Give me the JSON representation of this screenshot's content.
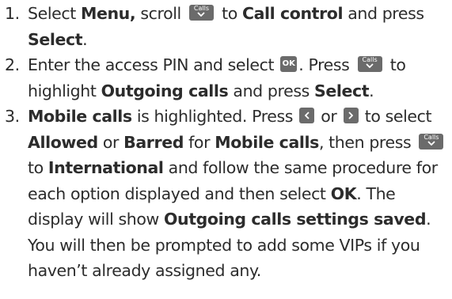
{
  "steps": [
    {
      "number": "1.",
      "s1": "Select ",
      "b1": "Menu,",
      "s2": " scroll ",
      "key1": "Calls",
      "s3": " to ",
      "b2": "Call control",
      "s4": " and press ",
      "b3": "Select",
      "s5": "."
    },
    {
      "number": "2.",
      "s1": "Enter the access PIN and select ",
      "key_ok": "OK",
      "s2": ". Press ",
      "key1": "Calls",
      "s3": " to highlight ",
      "b1": "Outgoing calls",
      "s4": " and press ",
      "b2": "Select",
      "s5": "."
    },
    {
      "number": "3.",
      "b1": "Mobile calls",
      "s1": " is highlighted. Press ",
      "left_key": "chevron-left-icon",
      "s2": " or ",
      "right_key": "chevron-right-icon",
      "s3": " to select ",
      "b2": "Allowed",
      "s4": " or ",
      "b3": "Barred",
      "s5": " for ",
      "b4": "Mobile calls",
      "s6": ", then press ",
      "key1": "Calls",
      "s7": " to ",
      "b5": "International",
      "s8": " and follow the same procedure for each option displayed and then select ",
      "b6": "OK",
      "s9": ". The display will show ",
      "b7": "Outgoing calls settings saved",
      "s10": ". You will then be prompted to add some VIPs if you haven’t already assigned any."
    }
  ],
  "colors": {
    "text": "#2c2c2c",
    "key_background": "#6b6b6b",
    "key_text": "#ffffff"
  }
}
